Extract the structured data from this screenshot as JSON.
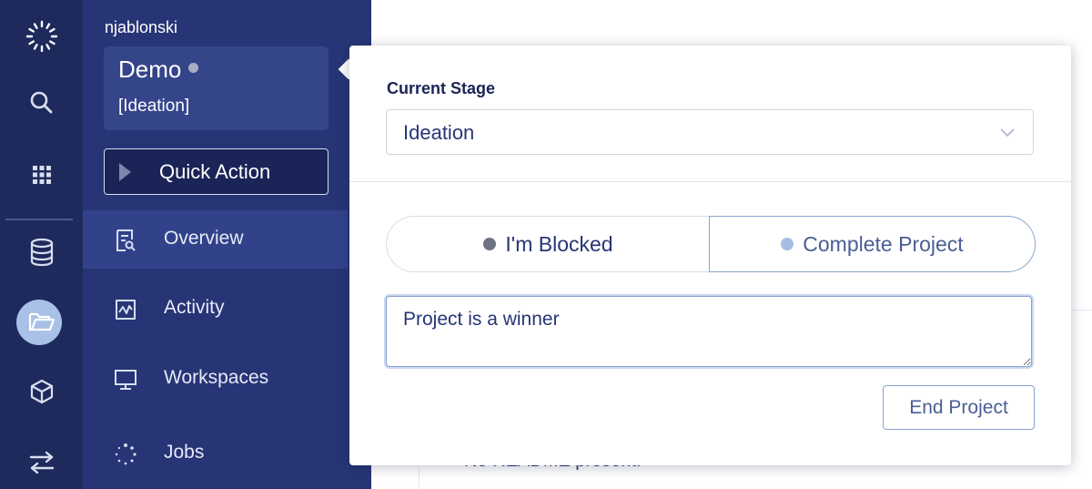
{
  "user": {
    "name": "njablonski"
  },
  "project": {
    "name": "Demo",
    "stage_tag": "[Ideation]",
    "status_color": "#a7afc4"
  },
  "quick_action": {
    "label": "Quick Action"
  },
  "nav": {
    "items": [
      {
        "label": "Overview",
        "icon": "overview-icon",
        "active": true
      },
      {
        "label": "Activity",
        "icon": "activity-icon",
        "active": false
      },
      {
        "label": "Workspaces",
        "icon": "monitor-icon",
        "active": false
      },
      {
        "label": "Jobs",
        "icon": "jobs-spinner-icon",
        "active": false
      }
    ]
  },
  "rail": {
    "icons": [
      "logo-icon",
      "search-icon",
      "apps-grid-icon",
      "database-icon",
      "folder-icon",
      "cube-icon",
      "transfer-icon"
    ],
    "active": "folder-icon"
  },
  "popover": {
    "stage_label": "Current Stage",
    "stage_value": "Ideation",
    "blocked_label": "I'm Blocked",
    "complete_label": "Complete Project",
    "note_value": "Project is a winner",
    "end_label": "End Project"
  },
  "background": {
    "partial_text": "No README present."
  },
  "colors": {
    "rail_bg": "#1e2a5c",
    "nav_bg": "#273576",
    "nav_active_bg": "#32428a",
    "accent_light": "#a9c1e6",
    "text_dark_blue": "#273576",
    "border_blue": "#8aa3cf"
  }
}
